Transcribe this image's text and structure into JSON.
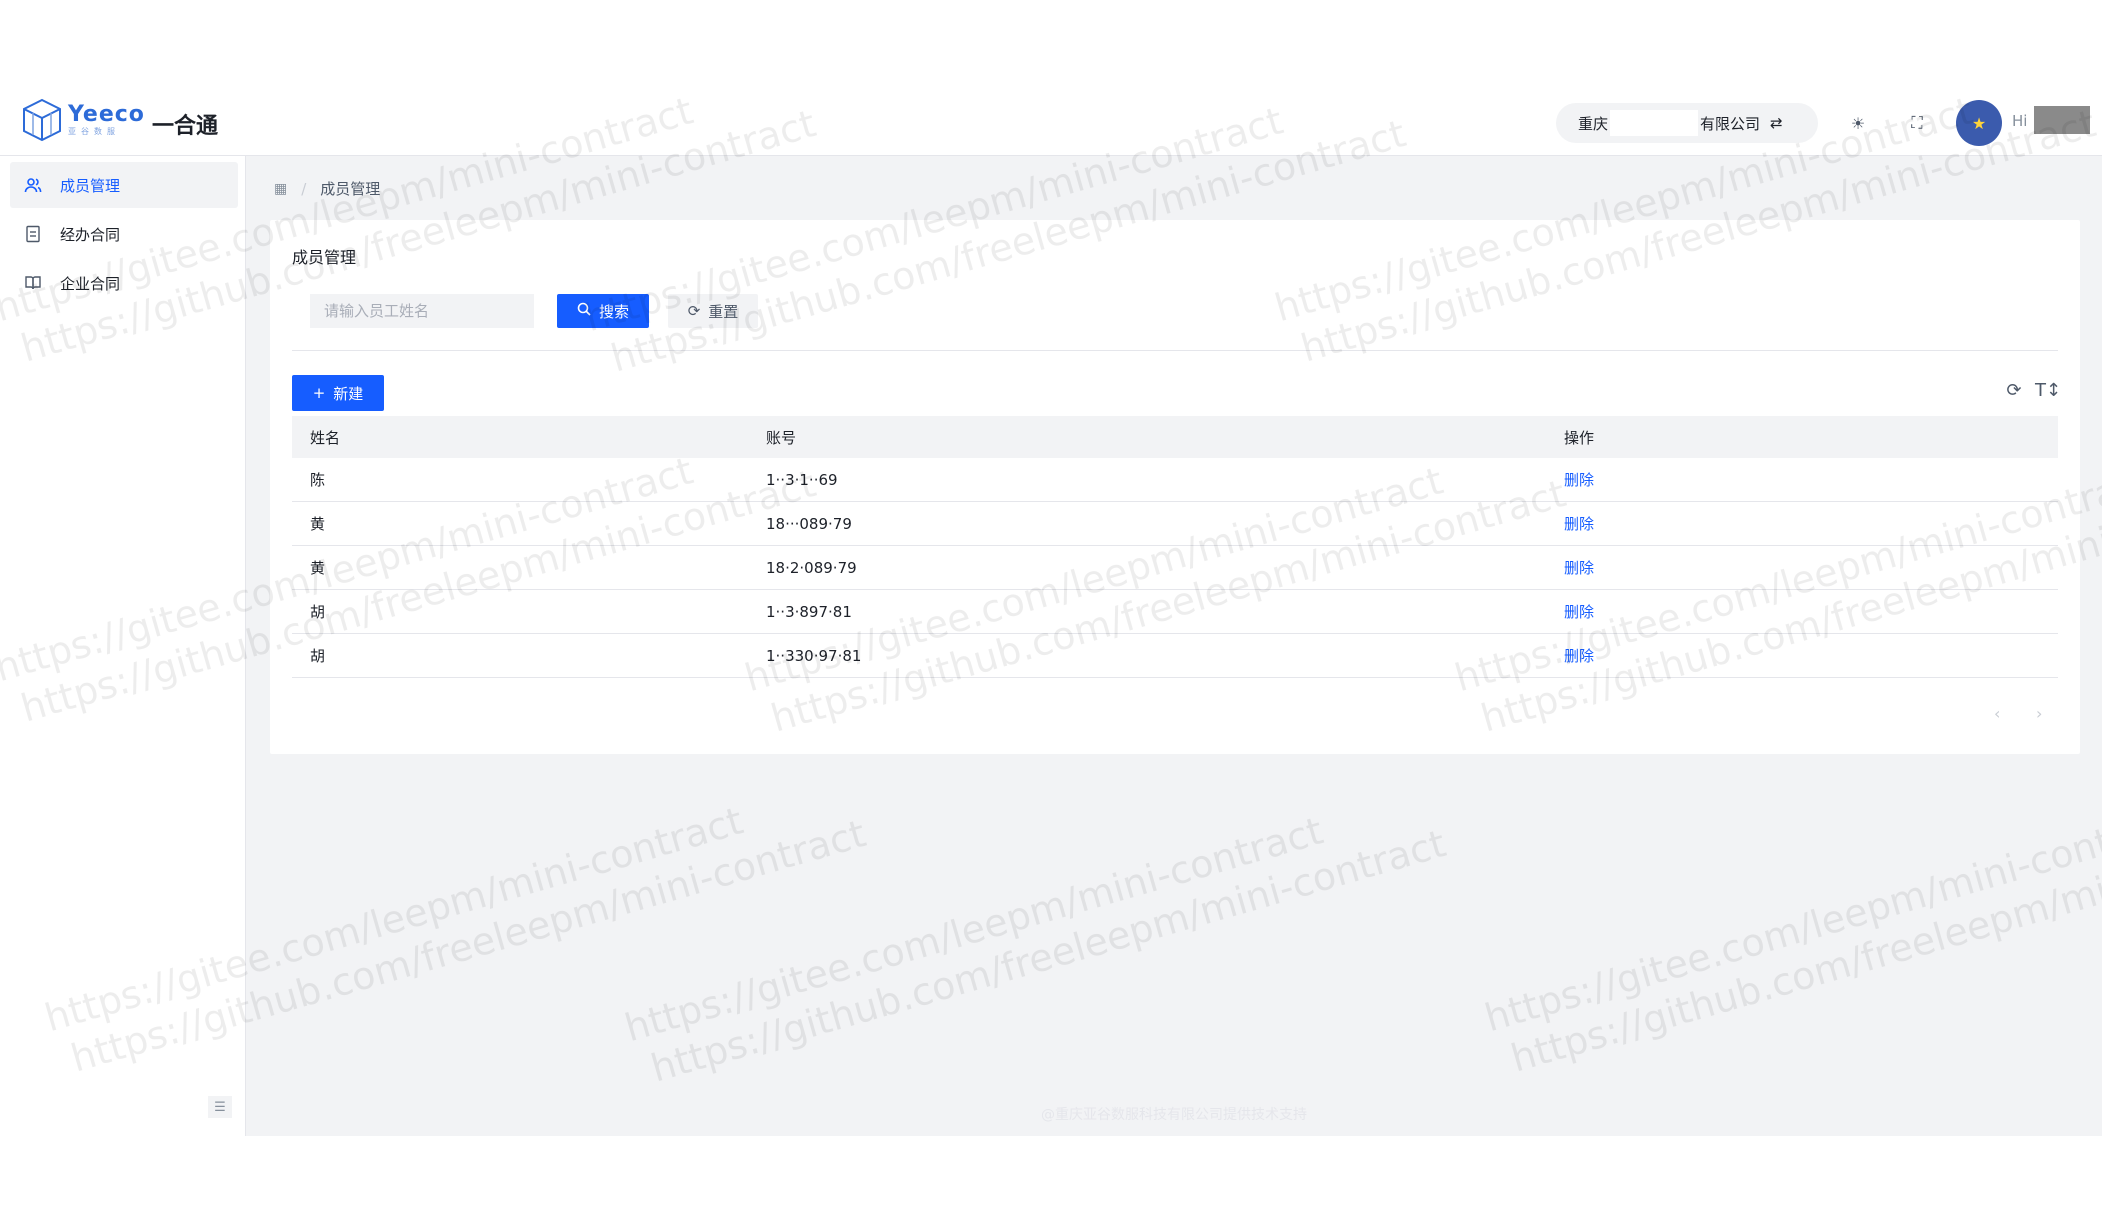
{
  "header": {
    "logo_brand": "Yeeco",
    "logo_sub": "亚谷数服",
    "app_title": "一合通",
    "company_prefix": "重庆",
    "company_suffix": "有限公司",
    "greeting": "Hi"
  },
  "sidebar": {
    "items": [
      {
        "label": "成员管理",
        "icon": "users-icon",
        "active": true
      },
      {
        "label": "经办合同",
        "icon": "document-icon",
        "active": false
      },
      {
        "label": "企业合同",
        "icon": "book-icon",
        "active": false
      }
    ]
  },
  "breadcrumb": {
    "current": "成员管理"
  },
  "card": {
    "title": "成员管理",
    "search_placeholder": "请输入员工姓名",
    "search_label": "搜索",
    "reset_label": "重置",
    "new_label": "新建"
  },
  "table": {
    "columns": [
      "姓名",
      "账号",
      "操作"
    ],
    "rows": [
      {
        "name": "陈",
        "account": "1··3·1··69",
        "action": "删除"
      },
      {
        "name": "黄",
        "account": "18···089·79",
        "action": "删除"
      },
      {
        "name": "黄",
        "account": "18·2·089·79",
        "action": "删除"
      },
      {
        "name": "胡",
        "account": "1··3·897·81",
        "action": "删除"
      },
      {
        "name": "胡",
        "account": "1··330·97·81",
        "action": "删除"
      }
    ]
  },
  "footer": {
    "note": "@重庆亚谷数服科技有限公司提供技术支持"
  },
  "watermark": {
    "line1": "https://gitee.com/leepm/mini-contract",
    "line2": "https://github.com/freeleepm/mini-contract"
  },
  "colors": {
    "primary": "#165dff",
    "avatar": "#3b5bad"
  }
}
